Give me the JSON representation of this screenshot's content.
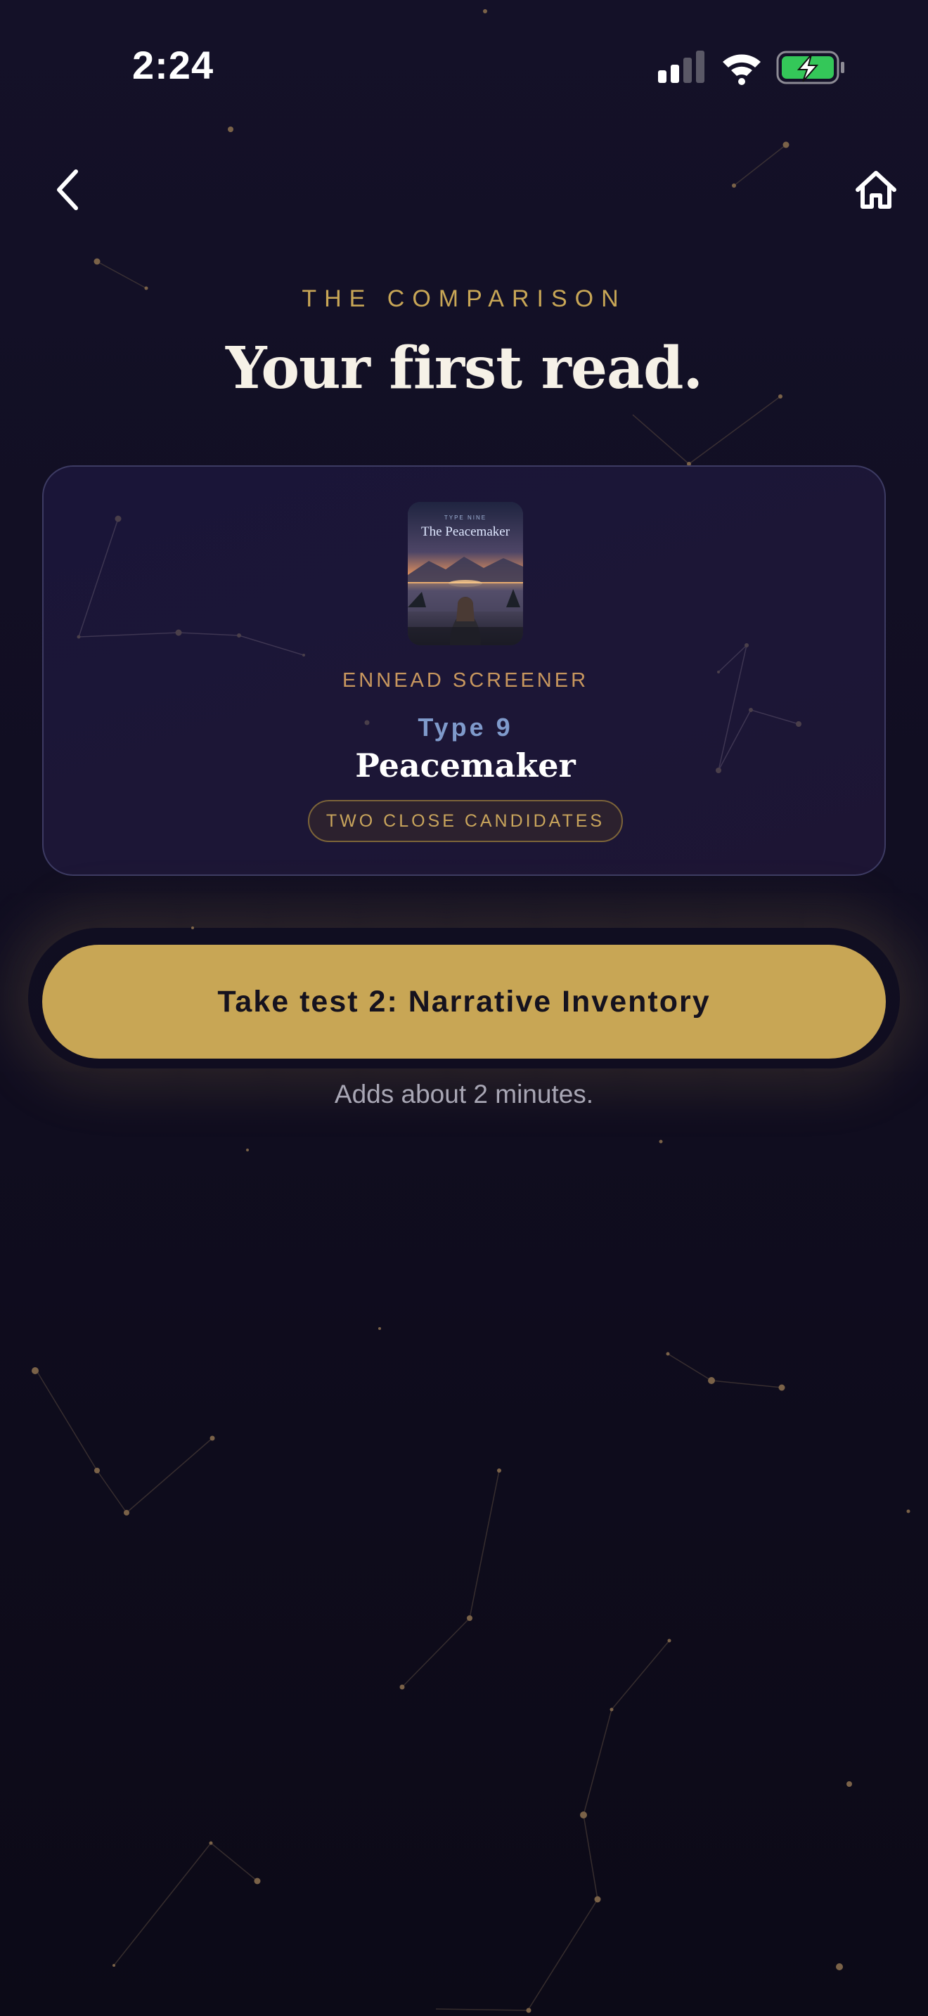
{
  "status_bar": {
    "time": "2:24",
    "icons": [
      "cellular-signal-icon",
      "wifi-icon",
      "battery-charging-icon"
    ]
  },
  "nav": {
    "back_icon": "chevron-left-icon",
    "home_icon": "home-icon"
  },
  "header": {
    "eyebrow": "THE COMPARISON",
    "title": "Your first read."
  },
  "result_card": {
    "cover": {
      "kicker": "TYPE NINE",
      "title": "The Peacemaker"
    },
    "source_label": "ENNEAD SCREENER",
    "type_number": "Type 9",
    "type_name": "Peacemaker",
    "badge": "TWO CLOSE CANDIDATES"
  },
  "cta": {
    "label": "Take test 2: Narrative Inventory",
    "note": "Adds about 2 minutes."
  },
  "colors": {
    "background": "#110e22",
    "accent_gold": "#c8a655",
    "card_border": "#3d3b63",
    "type_blue": "#7f9acb",
    "battery_green": "#34c759"
  }
}
